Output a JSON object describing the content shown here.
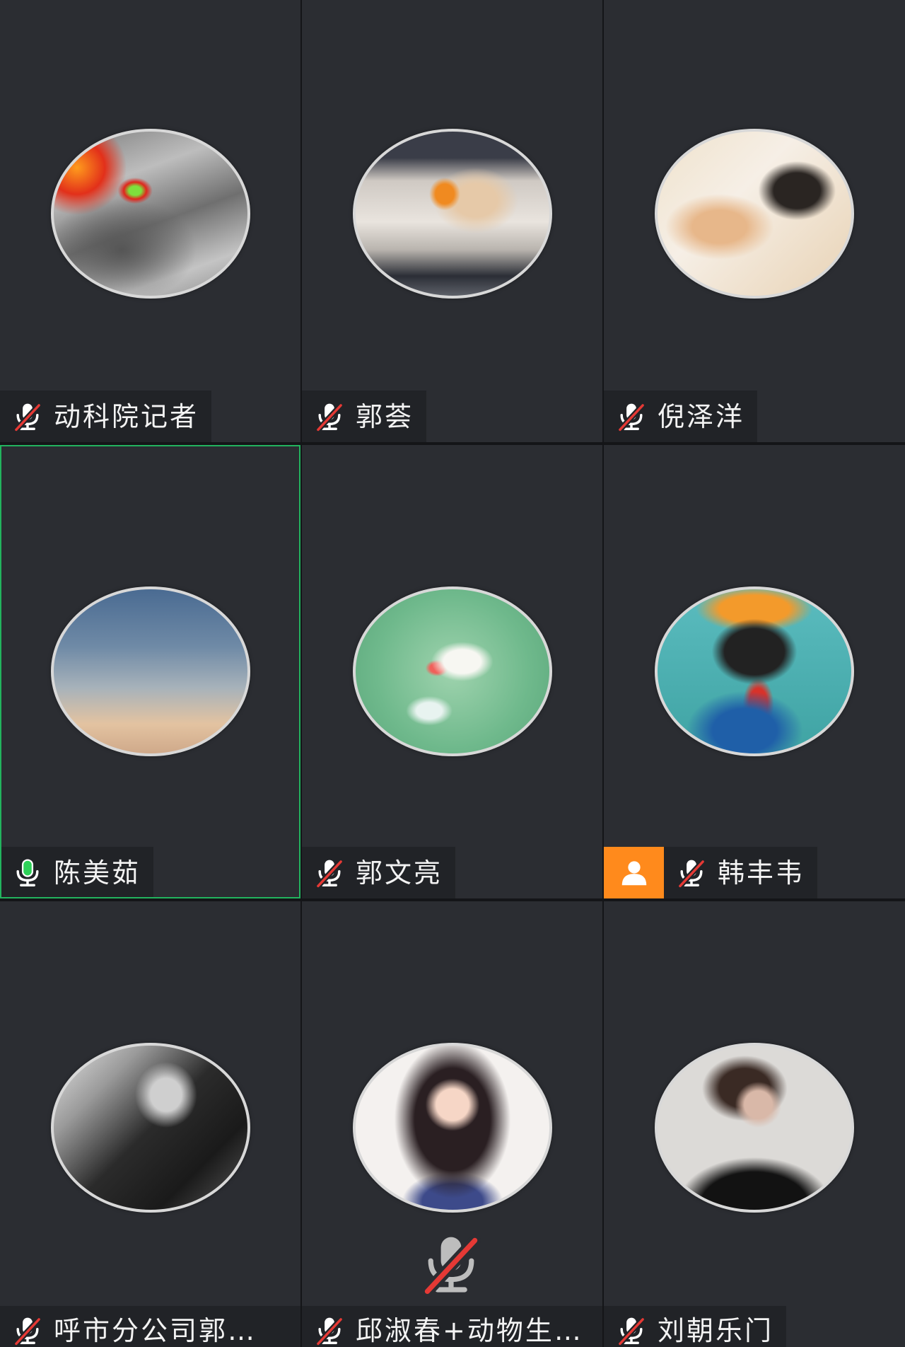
{
  "participants": [
    {
      "name": "动科院记者",
      "mic_icon": "mic-muted-icon"
    },
    {
      "name": "郭荟",
      "mic_icon": "mic-muted-icon"
    },
    {
      "name": "倪泽洋",
      "mic_icon": "mic-muted-icon"
    },
    {
      "name": "陈美茹",
      "mic_icon": "mic-active-icon",
      "active": true
    },
    {
      "name": "郭文亮",
      "mic_icon": "mic-muted-icon"
    },
    {
      "name": "韩丰韦",
      "mic_icon": "mic-muted-icon",
      "badge_icon": "person-icon"
    },
    {
      "name": "呼市分公司郭…",
      "mic_icon": "mic-muted-icon"
    },
    {
      "name": "邱淑春+动物生…",
      "mic_icon": "mic-muted-icon"
    },
    {
      "name": "刘朝乐门",
      "mic_icon": "mic-muted-icon"
    }
  ],
  "floating_mic": {
    "icon": "mic-muted-icon"
  },
  "colors": {
    "tile_bg": "#2b2d32",
    "label_bg": "#212327",
    "active_border": "#22b35e",
    "speaking_mic": "#2ed158",
    "mute_slash": "#e53935",
    "badge_bg": "#ff8a1c"
  }
}
